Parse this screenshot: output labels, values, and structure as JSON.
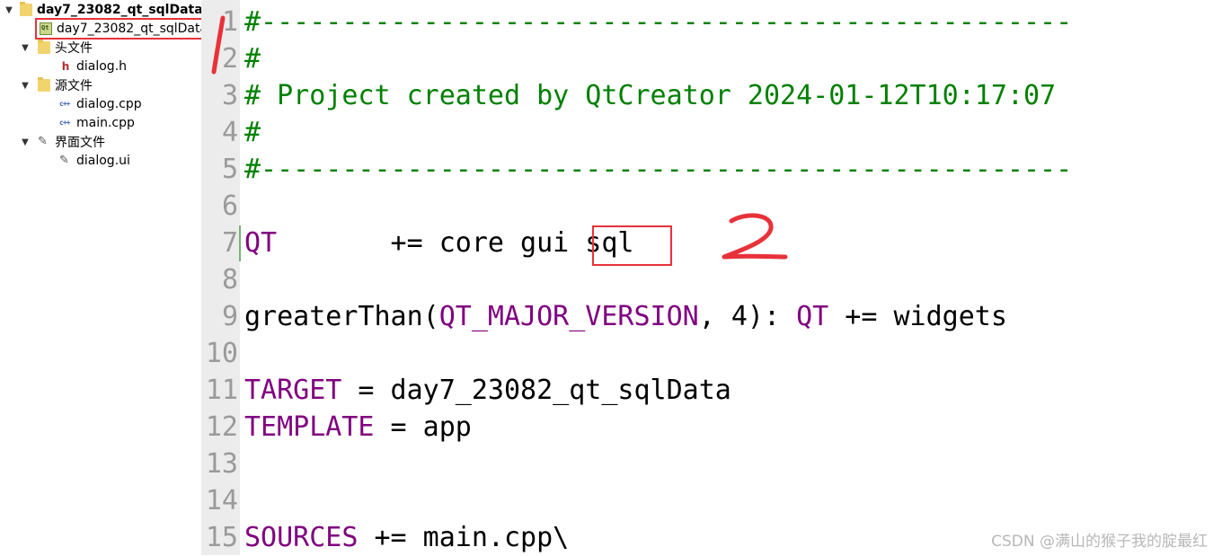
{
  "project_tree": {
    "root_label": "day7_23082_qt_sqlData",
    "pro_file_label": "day7_23082_qt_sqlData",
    "headers_folder": "头文件",
    "header_file": "dialog.h",
    "sources_folder": "源文件",
    "source_files": [
      "dialog.cpp",
      "main.cpp"
    ],
    "forms_folder": "界面文件",
    "form_file": "dialog.ui"
  },
  "editor": {
    "lines": [
      {
        "num": "1",
        "segments": [
          {
            "t": "#--------------------------------------------------",
            "c": "cmt"
          }
        ]
      },
      {
        "num": "2",
        "segments": [
          {
            "t": "#",
            "c": "cmt"
          }
        ]
      },
      {
        "num": "3",
        "segments": [
          {
            "t": "# Project created by QtCreator 2024-01-12T10:17:07",
            "c": "cmt"
          }
        ]
      },
      {
        "num": "4",
        "segments": [
          {
            "t": "#",
            "c": "cmt"
          }
        ]
      },
      {
        "num": "5",
        "segments": [
          {
            "t": "#--------------------------------------------------",
            "c": "cmt"
          }
        ]
      },
      {
        "num": "6",
        "segments": []
      },
      {
        "num": "7",
        "segments": [
          {
            "t": "QT",
            "c": "kw"
          },
          {
            "t": "       += core gui sql",
            "c": "txt"
          }
        ]
      },
      {
        "num": "8",
        "segments": []
      },
      {
        "num": "9",
        "segments": [
          {
            "t": "greaterThan(",
            "c": "txt"
          },
          {
            "t": "QT_MAJOR_VERSION",
            "c": "kw"
          },
          {
            "t": ", 4): ",
            "c": "txt"
          },
          {
            "t": "QT",
            "c": "kw"
          },
          {
            "t": " += widgets",
            "c": "txt"
          }
        ]
      },
      {
        "num": "10",
        "segments": []
      },
      {
        "num": "11",
        "segments": [
          {
            "t": "TARGET",
            "c": "kw"
          },
          {
            "t": " = day7_23082_qt_sqlData",
            "c": "txt"
          }
        ]
      },
      {
        "num": "12",
        "segments": [
          {
            "t": "TEMPLATE",
            "c": "kw"
          },
          {
            "t": " = app",
            "c": "txt"
          }
        ]
      },
      {
        "num": "13",
        "segments": []
      },
      {
        "num": "14",
        "segments": []
      },
      {
        "num": "15",
        "segments": [
          {
            "t": "SOURCES",
            "c": "kw"
          },
          {
            "t": " += main.cpp\\",
            "c": "txt"
          }
        ]
      }
    ]
  },
  "colors": {
    "comment": "#008000",
    "keyword": "#800080",
    "annotation_red": "#e8323a"
  },
  "watermark": "CSDN @满山的猴子我的腚最红"
}
